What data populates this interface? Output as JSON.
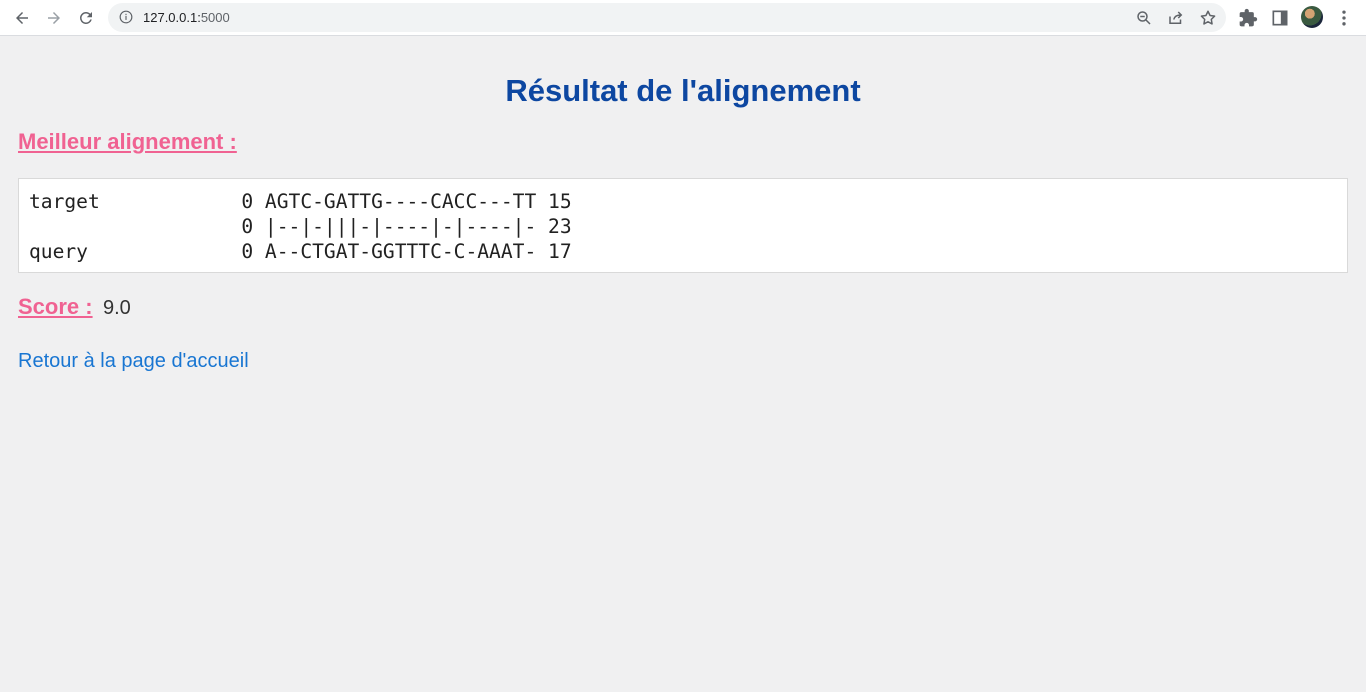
{
  "browser": {
    "url_host": "127.0.0.1:",
    "url_port": "5000"
  },
  "page": {
    "title": "Résultat de l'alignement",
    "best_alignment_label": "Meilleur alignement :",
    "alignment_lines": [
      "target            0 AGTC-GATTG----CACC---TT 15",
      "                  0 |--|-|||-|----|-|----|- 23",
      "query             0 A--CTGAT-GGTTTC-C-AAAT- 17"
    ],
    "score_label": "Score :",
    "score_value": "9.0",
    "home_link": "Retour à la page d'accueil"
  },
  "colors": {
    "title": "#0d47a1",
    "heading": "#f06292",
    "link": "#1976d2"
  }
}
